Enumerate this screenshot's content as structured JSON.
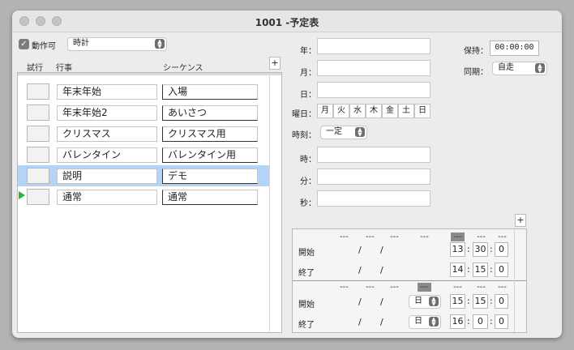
{
  "window": {
    "title": "1001 -予定表"
  },
  "toolbar": {
    "enabled_label": "動作可",
    "enabled_checked": true,
    "mode_value": "時計"
  },
  "table": {
    "headers": {
      "test": "試行",
      "event": "行事",
      "sequence": "シーケンス"
    },
    "rows": [
      {
        "event": "年末年始",
        "sequence": "入場"
      },
      {
        "event": "年末年始2",
        "sequence": "あいさつ"
      },
      {
        "event": "クリスマス",
        "sequence": "クリスマス用"
      },
      {
        "event": "バレンタイン",
        "sequence": "バレンタイン用"
      },
      {
        "event": "説明",
        "sequence": "デモ",
        "selected": true
      },
      {
        "event": "通常",
        "sequence": "通常",
        "current": true
      }
    ],
    "add_label": "+"
  },
  "date": {
    "year_label": "年：",
    "month_label": "月：",
    "day_label": "日：",
    "weekday_label": "曜日：",
    "weekdays": [
      "月",
      "火",
      "水",
      "木",
      "金",
      "土",
      "日"
    ]
  },
  "time": {
    "mode_label": "時刻：",
    "mode_value": "一定",
    "hour_label": "時：",
    "minute_label": "分：",
    "second_label": "秒："
  },
  "hold": {
    "label": "保持：",
    "value": "00:00:00"
  },
  "sync": {
    "label": "同期：",
    "value": "自走"
  },
  "schedule": {
    "add_label": "+",
    "dash": "---",
    "slash": "/",
    "colon": ":",
    "block1": {
      "start": {
        "label": "開始",
        "h": "13",
        "m": "30",
        "s": "0"
      },
      "end": {
        "label": "終了",
        "h": "14",
        "m": "15",
        "s": "0"
      }
    },
    "block2": {
      "start": {
        "label": "開始",
        "day": "日",
        "h": "15",
        "m": "15",
        "s": "0"
      },
      "end": {
        "label": "終了",
        "day": "日",
        "h": "16",
        "m": "0",
        "s": "0"
      }
    }
  },
  "colors": {
    "selected_row": "#b3d4f7",
    "play_marker": "#22b33a"
  }
}
